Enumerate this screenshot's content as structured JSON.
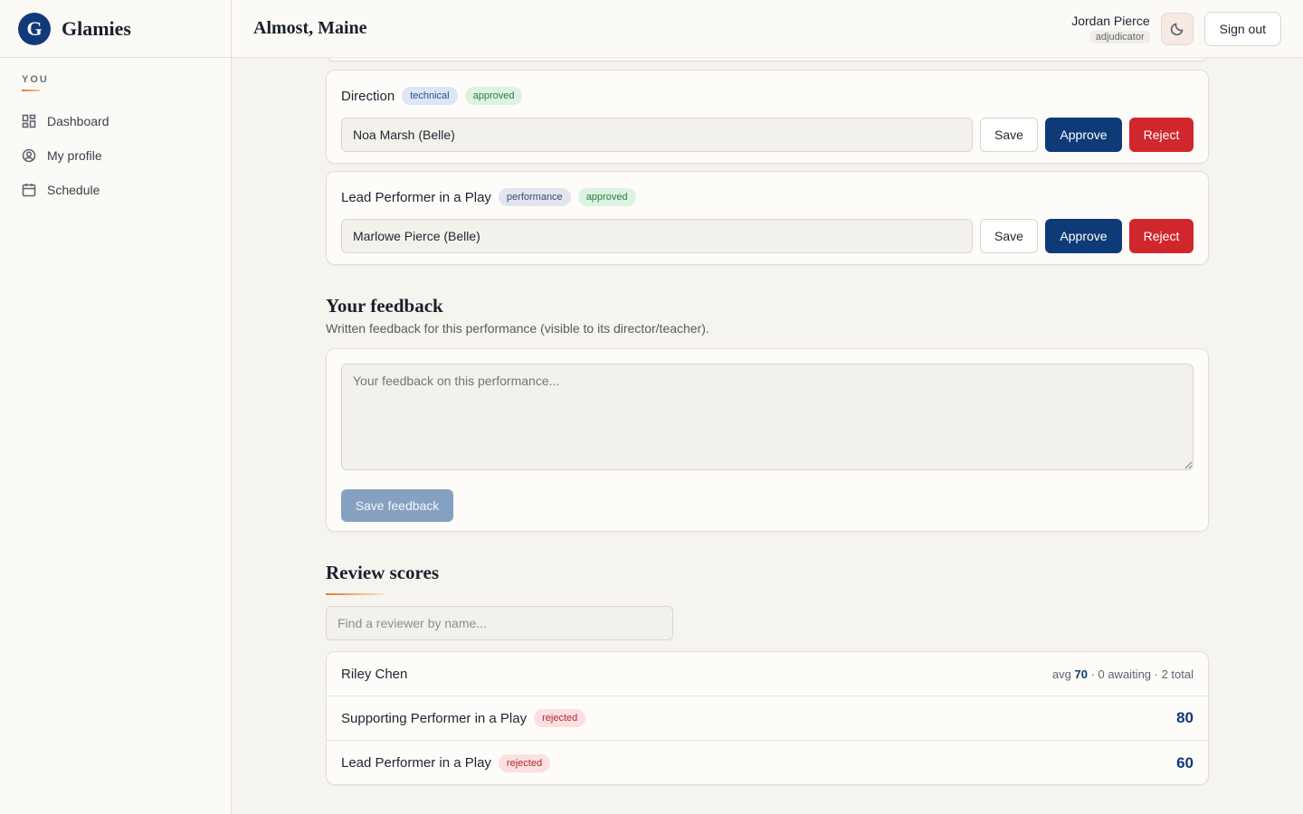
{
  "brand": {
    "name": "Glamies",
    "logo_letter": "G"
  },
  "sidebar": {
    "heading": "YOU",
    "items": [
      {
        "label": "Dashboard",
        "icon": "dashboard-icon"
      },
      {
        "label": "My profile",
        "icon": "user-circle-icon"
      },
      {
        "label": "Schedule",
        "icon": "calendar-icon"
      }
    ]
  },
  "header": {
    "title": "Almost, Maine",
    "user_name": "Jordan Pierce",
    "user_role": "adjudicator",
    "theme_icon": "moon-icon",
    "signout_label": "Sign out"
  },
  "awards": [
    {
      "title": "Direction",
      "category": "technical",
      "status": "approved",
      "value": "Noa Marsh (Belle)",
      "save_label": "Save",
      "approve_label": "Approve",
      "reject_label": "Reject"
    },
    {
      "title": "Lead Performer in a Play",
      "category": "performance",
      "status": "approved",
      "value": "Marlowe Pierce (Belle)",
      "save_label": "Save",
      "approve_label": "Approve",
      "reject_label": "Reject"
    }
  ],
  "feedback": {
    "title": "Your feedback",
    "subtitle": "Written feedback for this performance (visible to its director/teacher).",
    "placeholder": "Your feedback on this performance...",
    "button_label": "Save feedback"
  },
  "review_scores": {
    "title": "Review scores",
    "search_placeholder": "Find a reviewer by name...",
    "reviewer": {
      "name": "Riley Chen",
      "avg_label": "avg",
      "avg": "70",
      "summary": " · 0 awaiting · 2 total"
    },
    "scores": [
      {
        "award": "Supporting Performer in a Play",
        "status": "rejected",
        "score": "80"
      },
      {
        "award": "Lead Performer in a Play",
        "status": "rejected",
        "score": "60"
      }
    ]
  }
}
